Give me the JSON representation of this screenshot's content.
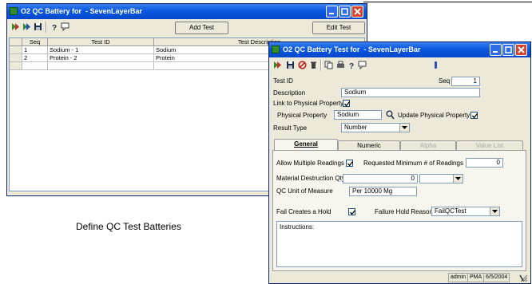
{
  "caption": "Define QC Test Batteries",
  "main_window": {
    "title": "O2 QC Battery for  - SevenLayerBar",
    "add_test_label": "Add Test",
    "edit_test_label": "Edit Test",
    "toolbar_icons": [
      "run-icon",
      "run-all-icon",
      "save-icon",
      "help-icon",
      "chat-icon"
    ],
    "columns": [
      "Seq",
      "Test ID",
      "Test Description"
    ],
    "rows": [
      {
        "seq": "1",
        "test_id": "Sodium - 1",
        "description": "Sodium"
      },
      {
        "seq": "2",
        "test_id": "Protein - 2",
        "description": "Protein"
      }
    ]
  },
  "detail_window": {
    "title": "O2 QC Battery Test for  - SevenLayerBar",
    "toolbar_icons": [
      "run-icon",
      "save-icon",
      "cancel-icon",
      "delete-icon",
      "copy-icon",
      "print-icon",
      "help-icon",
      "chat-icon",
      "info-icon"
    ],
    "test_id_label": "Test ID",
    "seq_label": "Seq",
    "seq_value": "1",
    "description_label": "Description",
    "description_value": "Sodium",
    "link_label": "Link to Physical Property",
    "link_checked": true,
    "physical_property_label": "Physical Property",
    "physical_property_value": "Sodium",
    "update_label": "Update Physical Property",
    "update_checked": true,
    "result_type_label": "Result Type",
    "result_type_value": "Number",
    "tabs": [
      {
        "label": "General",
        "state": "active"
      },
      {
        "label": "Numeric",
        "state": "normal"
      },
      {
        "label": "Alpha",
        "state": "disabled"
      },
      {
        "label": "Value List",
        "state": "disabled"
      }
    ],
    "general": {
      "allow_multiple_label": "Allow Multiple Readings",
      "allow_multiple_checked": true,
      "requested_min_label": "Requested Minimum # of Readings",
      "requested_min_value": "0",
      "material_destruction_label": "Material Destruction Qty",
      "material_destruction_value": "0",
      "material_unit_value": "",
      "uom_label": "QC Unit of Measure",
      "uom_value": "Per 10000 Mg",
      "fail_hold_label": "Fail Creates a Hold",
      "fail_hold_checked": true,
      "failure_reason_label": "Failure Hold Reason",
      "failure_reason_value": "FailQCTest",
      "instructions_label": "Instructions:",
      "instructions_value": ""
    },
    "status": {
      "user": "admin",
      "site": "PMA",
      "date": "6/5/2004"
    }
  }
}
